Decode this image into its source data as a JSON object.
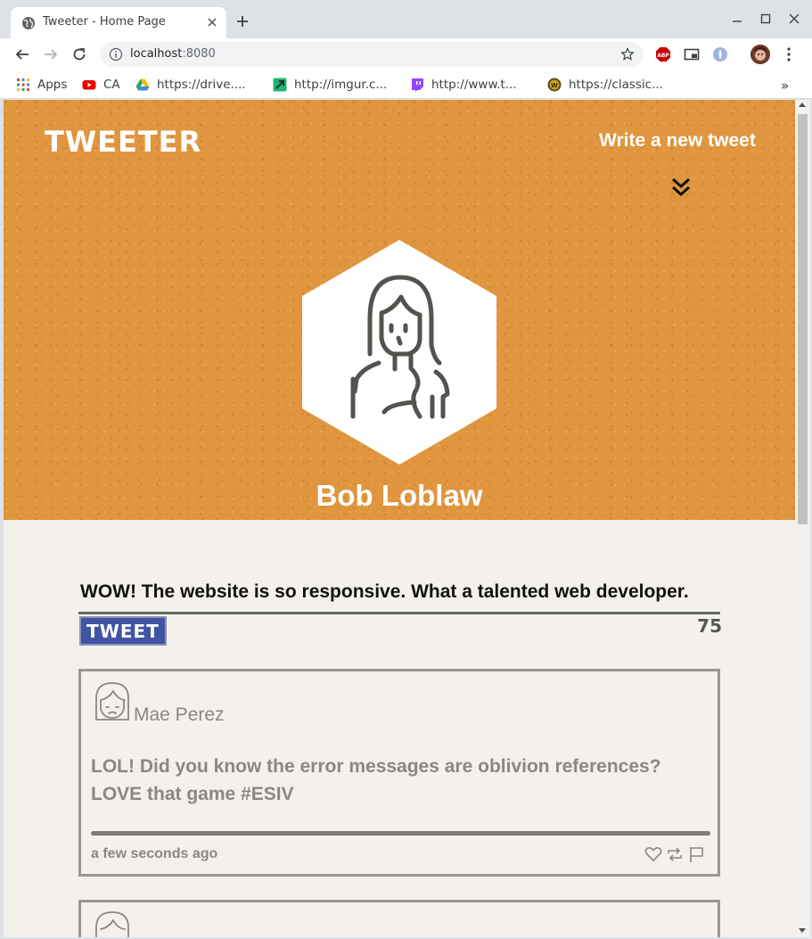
{
  "browser": {
    "tab_title": "Tweeter - Home Page",
    "url_host": "localhost",
    "url_port": ":8080",
    "bookmarks": [
      {
        "label": "Apps",
        "icon": "apps-grid-icon"
      },
      {
        "label": "CA",
        "icon": "youtube-icon"
      },
      {
        "label": "https://drive....",
        "icon": "google-drive-icon"
      },
      {
        "label": "http://imgur.c...",
        "icon": "imgur-icon"
      },
      {
        "label": "http://www.t...",
        "icon": "twitch-icon"
      },
      {
        "label": "https://classic...",
        "icon": "wow-icon"
      }
    ],
    "bookmarks_overflow": "»",
    "extensions": [
      "adblock-icon",
      "picture-in-picture-icon",
      "extension-icon"
    ]
  },
  "header": {
    "logo": "TWEETER",
    "write_link": "Write a new tweet",
    "profile_name": "Bob Loblaw",
    "accent_color": "#e0963f"
  },
  "compose": {
    "text": "WOW! The website is so responsive. What a talented web developer.",
    "button_label": "TWEET",
    "counter": "75"
  },
  "tweets": [
    {
      "author": "Mae Perez",
      "body": "LOL! Did you know the error messages are oblivion references? LOVE that game #ESIV",
      "time": "a few seconds ago",
      "actions": [
        "heart-icon",
        "retweet-icon",
        "flag-icon"
      ]
    }
  ]
}
